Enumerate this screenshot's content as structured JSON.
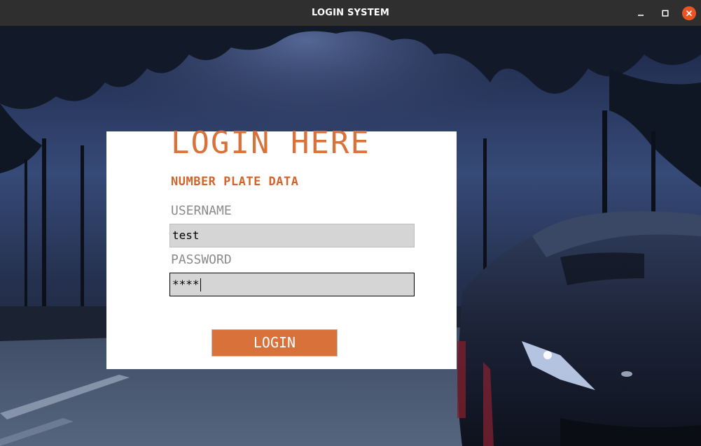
{
  "window": {
    "title": "LOGIN SYSTEM",
    "controls": [
      "minimize-icon",
      "maximize-icon",
      "close-icon"
    ],
    "close_color": "#e95420"
  },
  "login": {
    "heading": "LOGIN HERE",
    "subheading": "NUMBER PLATE DATA",
    "username_label": "USERNAME",
    "username_value": "test",
    "password_label": "PASSWORD",
    "password_value": "****",
    "button_label": "LOGIN"
  },
  "colors": {
    "accent": "#d9713a",
    "label_gray": "#8b8b8b",
    "entry_bg": "#d5d5d5"
  },
  "background": {
    "icon": "night-sports-car-photo"
  }
}
